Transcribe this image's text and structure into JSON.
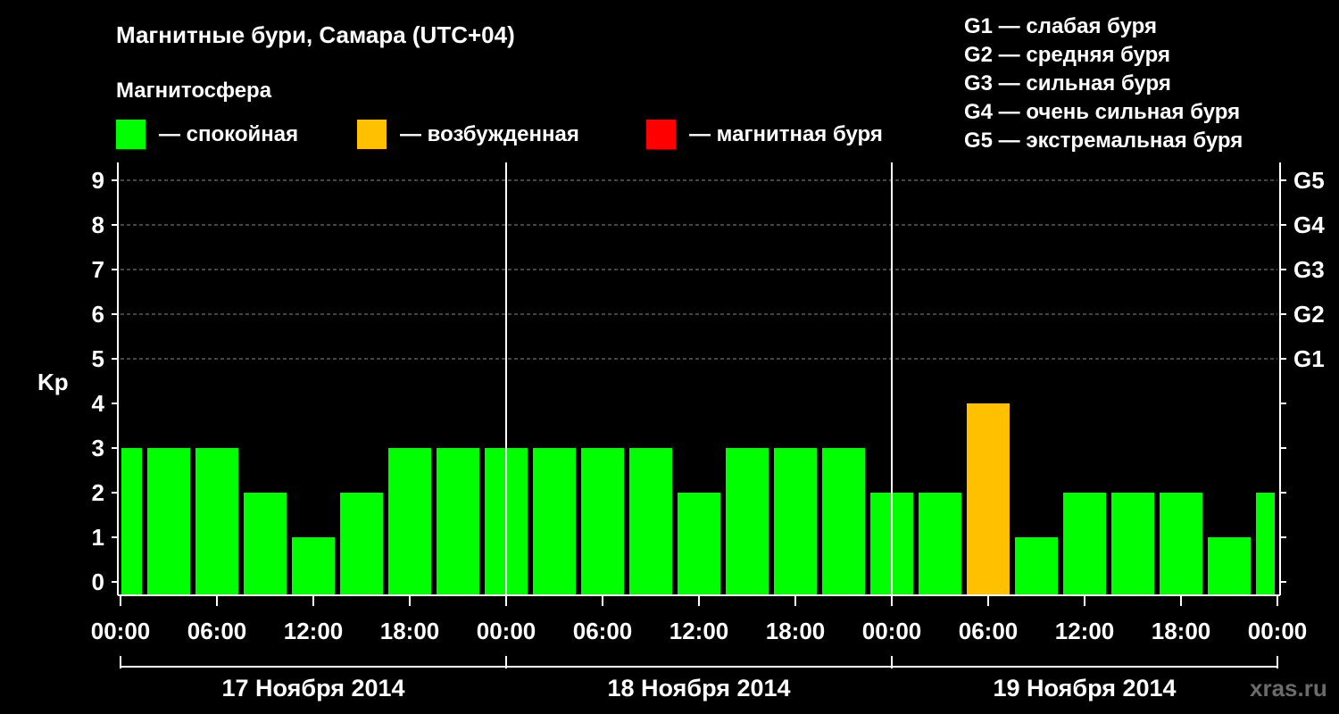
{
  "title": "Магнитные бури, Самара (UTC+04)",
  "subtitle": "Магнитосфера",
  "watermark": "xras.ru",
  "colors": {
    "background": "#000000",
    "axis": "#ffffff",
    "grid": "#8a8a8a",
    "quiet": "#00ff00",
    "excited": "#ffc000",
    "storm": "#ff0000"
  },
  "legend": [
    {
      "label": "— спокойная",
      "color": "#00ff00",
      "state": "quiet"
    },
    {
      "label": "— возбужденная",
      "color": "#ffc000",
      "state": "excited"
    },
    {
      "label": "— магнитная буря",
      "color": "#ff0000",
      "state": "storm"
    }
  ],
  "g_legend": [
    "G1 — слабая буря",
    "G2 — средняя буря",
    "G3 — сильная буря",
    "G4 — очень сильная буря",
    "G5 — экстремальная буря"
  ],
  "chart_data": {
    "type": "bar",
    "ylabel": "Kp",
    "ylim": [
      0,
      9
    ],
    "y_ticks": [
      "0",
      "1",
      "2",
      "3",
      "4",
      "5",
      "6",
      "7",
      "8",
      "9"
    ],
    "right_axis_labels": [
      {
        "kp": 5,
        "label": "G1"
      },
      {
        "kp": 6,
        "label": "G2"
      },
      {
        "kp": 7,
        "label": "G3"
      },
      {
        "kp": 8,
        "label": "G4"
      },
      {
        "kp": 9,
        "label": "G5"
      }
    ],
    "grid": "dashed horizontal at Kp 5–9",
    "x_ticks": [
      "00:00",
      "06:00",
      "12:00",
      "18:00",
      "00:00",
      "06:00",
      "12:00",
      "18:00",
      "00:00",
      "06:00",
      "12:00",
      "18:00",
      "00:00"
    ],
    "days": [
      "17 Ноября 2014",
      "18 Ноября 2014",
      "19 Ноября 2014"
    ],
    "bar_hours": 3,
    "series": [
      {
        "values": [
          3,
          3,
          3,
          2,
          1,
          2,
          3,
          3,
          3,
          3,
          3,
          3,
          2,
          3,
          3,
          3,
          2,
          2,
          4,
          1,
          2,
          2,
          2,
          1,
          2
        ],
        "states": [
          "quiet",
          "quiet",
          "quiet",
          "quiet",
          "quiet",
          "quiet",
          "quiet",
          "quiet",
          "quiet",
          "quiet",
          "quiet",
          "quiet",
          "quiet",
          "quiet",
          "quiet",
          "quiet",
          "quiet",
          "quiet",
          "excited",
          "quiet",
          "quiet",
          "quiet",
          "quiet",
          "quiet",
          "quiet"
        ]
      }
    ]
  }
}
